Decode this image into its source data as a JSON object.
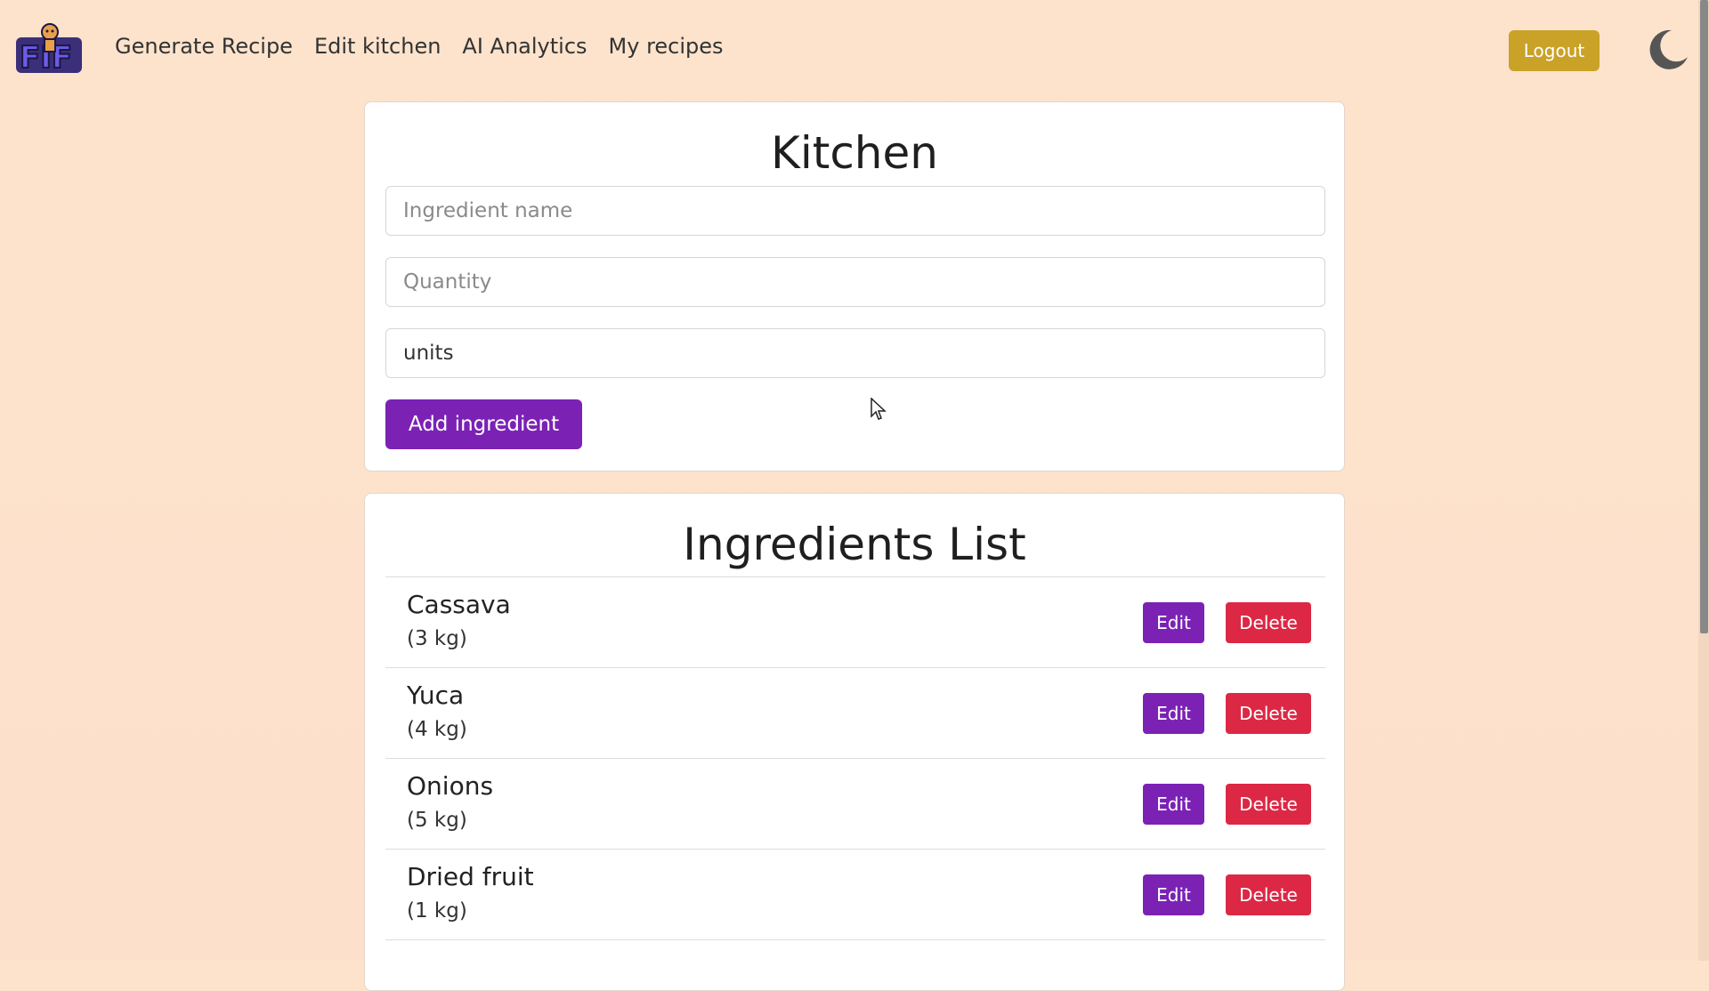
{
  "nav": {
    "links": [
      "Generate Recipe",
      "Edit kitchen",
      "AI Analytics",
      "My recipes"
    ],
    "logout_label": "Logout"
  },
  "kitchen": {
    "title": "Kitchen",
    "name_placeholder": "Ingredient name",
    "quantity_placeholder": "Quantity",
    "units_value": "units",
    "add_label": "Add ingredient"
  },
  "ingredients": {
    "title": "Ingredients List",
    "edit_label": "Edit",
    "delete_label": "Delete",
    "items": [
      {
        "name": "Cassava",
        "qty": "(3 kg)"
      },
      {
        "name": "Yuca",
        "qty": "(4 kg)"
      },
      {
        "name": "Onions",
        "qty": "(5 kg)"
      },
      {
        "name": "Dried fruit",
        "qty": "(1 kg)"
      }
    ]
  },
  "colors": {
    "background": "#fde3cc",
    "primary": "#7b22b5",
    "danger": "#dc2845",
    "logout": "#c9a227"
  },
  "icons": [
    "app-logo",
    "moon-icon",
    "cursor-icon"
  ]
}
